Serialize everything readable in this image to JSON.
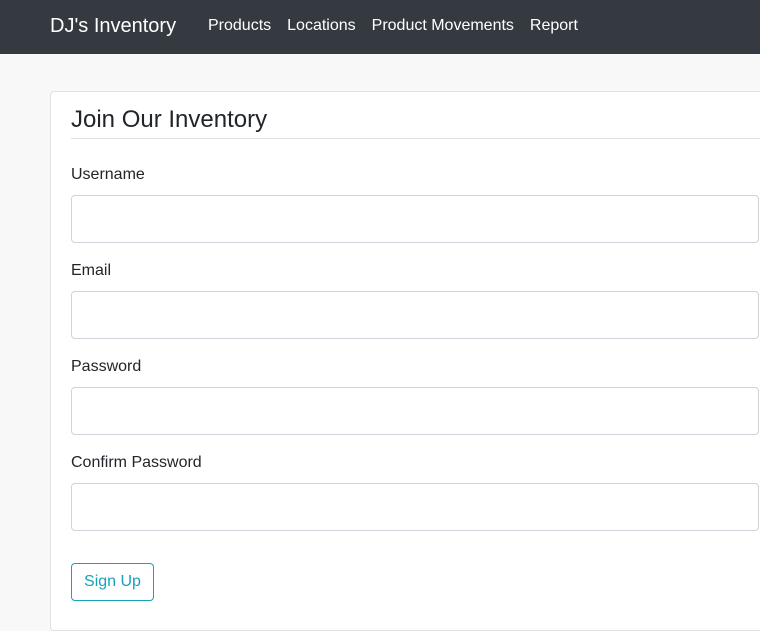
{
  "navbar": {
    "brand": "DJ's Inventory",
    "links": [
      {
        "label": "Products"
      },
      {
        "label": "Locations"
      },
      {
        "label": "Product Movements"
      },
      {
        "label": "Report"
      }
    ]
  },
  "form": {
    "title": "Join Our Inventory",
    "fields": [
      {
        "label": "Username",
        "value": ""
      },
      {
        "label": "Email",
        "value": ""
      },
      {
        "label": "Password",
        "value": ""
      },
      {
        "label": "Confirm Password",
        "value": ""
      }
    ],
    "submit_label": "Sign Up"
  },
  "colors": {
    "navbar_bg": "#343a40",
    "accent": "#17a2b8",
    "page_bg": "#f8f8f8"
  }
}
